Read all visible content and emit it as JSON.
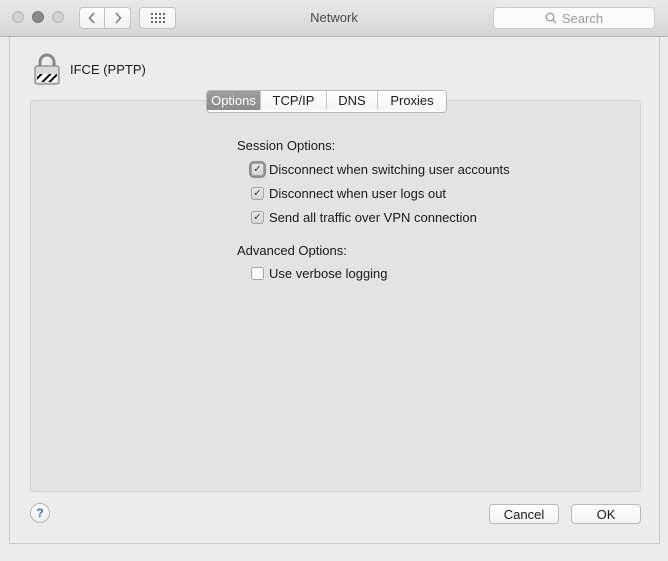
{
  "window": {
    "title": "Network",
    "search_placeholder": "Search"
  },
  "service": {
    "name": "IFCE (PPTP)",
    "icon": "lock-icon"
  },
  "tabs": [
    {
      "label": "Options",
      "active": true
    },
    {
      "label": "TCP/IP",
      "active": false
    },
    {
      "label": "DNS",
      "active": false
    },
    {
      "label": "Proxies",
      "active": false
    }
  ],
  "session_options": {
    "heading": "Session Options:",
    "items": [
      {
        "label": "Disconnect when switching user accounts",
        "checked": true
      },
      {
        "label": "Disconnect when user logs out",
        "checked": true
      },
      {
        "label": "Send all traffic over VPN connection",
        "checked": true
      }
    ]
  },
  "advanced_options": {
    "heading": "Advanced Options:",
    "items": [
      {
        "label": "Use verbose logging",
        "checked": false
      }
    ]
  },
  "footer": {
    "help_label": "?",
    "cancel_label": "Cancel",
    "ok_label": "OK"
  }
}
